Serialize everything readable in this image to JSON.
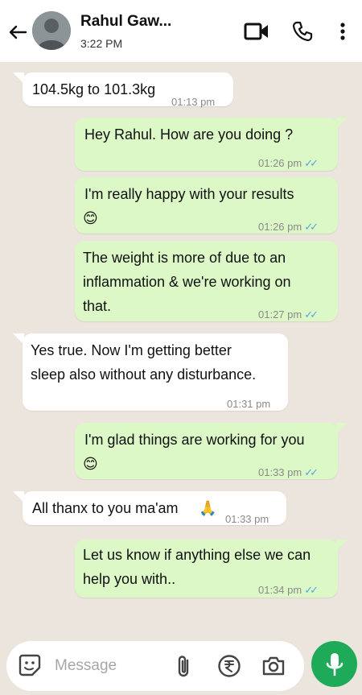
{
  "header": {
    "name": "Rahul Gaw...",
    "status": "3:22 PM"
  },
  "messages": [
    {
      "dir": "in",
      "text": "104.5kg to 101.3kg",
      "time": "01:13 pm"
    },
    {
      "dir": "out",
      "text": "Hey Rahul. How are you doing ?",
      "time": "01:26 pm"
    },
    {
      "dir": "out",
      "text": "I'm really happy with your results",
      "emoji": "😊",
      "time": "01:26 pm"
    },
    {
      "dir": "out",
      "text": "The weight is more of due to an\ninflammation & we're working on\nthat.",
      "time": "01:27 pm"
    },
    {
      "dir": "in",
      "text": "Yes true. Now I'm getting better\nsleep also without any disturbance.",
      "time": "01:31 pm"
    },
    {
      "dir": "out",
      "text": "I'm glad things are working for you",
      "emoji": "😊",
      "time": "01:33 pm"
    },
    {
      "dir": "in",
      "text": "All thanx to you ma'am",
      "emoji": "🙏",
      "time": "01:33 pm"
    },
    {
      "dir": "out",
      "text": "Let us know if anything else we can\nhelp you with..",
      "time": "01:34 pm"
    }
  ],
  "composer": {
    "placeholder": "Message"
  },
  "colors": {
    "chat_bg": "#ece5dd",
    "outgoing_bubble": "#dcf8c6",
    "incoming_bubble": "#ffffff",
    "mic_button": "#1faa59",
    "read_ticks": "#53a6e0"
  },
  "icons": [
    "back-arrow-icon",
    "video-call-icon",
    "phone-icon",
    "more-vert-icon",
    "sticker-icon",
    "attach-icon",
    "rupee-icon",
    "camera-icon",
    "mic-icon"
  ]
}
